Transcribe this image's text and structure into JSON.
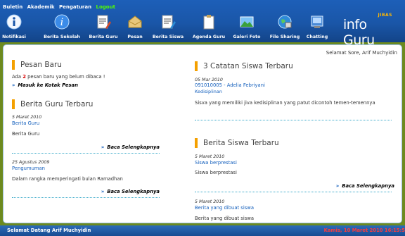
{
  "topmenu": {
    "items": [
      "Buletin",
      "Akademik",
      "Pengaturan"
    ],
    "logout": "Logout"
  },
  "nav": [
    {
      "label": "Notifikasi",
      "icon": "info-icon"
    },
    {
      "label": "Berita Sekolah",
      "icon": "info-icon"
    },
    {
      "label": "Berita Guru",
      "icon": "document-icon"
    },
    {
      "label": "Pesan",
      "icon": "envelope-icon"
    },
    {
      "label": "Berita Siswa",
      "icon": "document-icon"
    },
    {
      "label": "Agenda Guru",
      "icon": "clipboard-icon"
    },
    {
      "label": "Galeri Foto",
      "icon": "picture-icon"
    },
    {
      "label": "File Sharing",
      "icon": "globe-icon"
    },
    {
      "label": "Chatting",
      "icon": "chat-icon"
    }
  ],
  "brand": {
    "tag": "JIBAS",
    "name": "info Guru"
  },
  "greeting": "Selamat Sore, Arif Muchyidin",
  "pesan_baru": {
    "title": "Pesan Baru",
    "text_prefix": "Ada",
    "count": "2",
    "text_suffix": "pesan baru yang belum dibaca !",
    "link": "Masuk ke Kotak Pesan"
  },
  "berita_guru": {
    "title": "Berita Guru Terbaru",
    "items": [
      {
        "date": "5 Maret 2010",
        "category": "Berita Guru",
        "body": "Berita Guru",
        "more": "Baca Selengkapnya"
      },
      {
        "date": "25 Agustus 2009",
        "category": "Pengumuman",
        "body": "Dalam rangka memperingati bulan Ramadhan",
        "more": "Baca Selengkapnya"
      }
    ]
  },
  "catatan_siswa": {
    "title": "3 Catatan Siswa Terbaru",
    "items": [
      {
        "date": "05 Mar 2010",
        "student": "091010005 - Adelia Febriyani",
        "category": "Kedisiplinan",
        "body": "Sisva yang memiliki jiva kedisiplinan yang patut dicontoh temen-temennya"
      }
    ]
  },
  "berita_siswa": {
    "title": "Berita Siswa Terbaru",
    "items": [
      {
        "date": "5 Maret 2010",
        "category": "Siswa berprestasi",
        "body": "Siswa berprestasi",
        "more": "Baca Selengkapnya"
      },
      {
        "date": "5 Maret 2010",
        "category": "Berita yang dibuat siswa",
        "body": "Berita yang dibuat siswa"
      }
    ]
  },
  "footer": {
    "welcome": "Selamat Datang Arif Muchyidin",
    "datetime": "Kamis, 10 Maret 2010 16:15:5"
  },
  "colors": {
    "header": "#1a56a8",
    "accent": "#f4a000",
    "link": "#1560bd",
    "alert": "#d80000"
  }
}
